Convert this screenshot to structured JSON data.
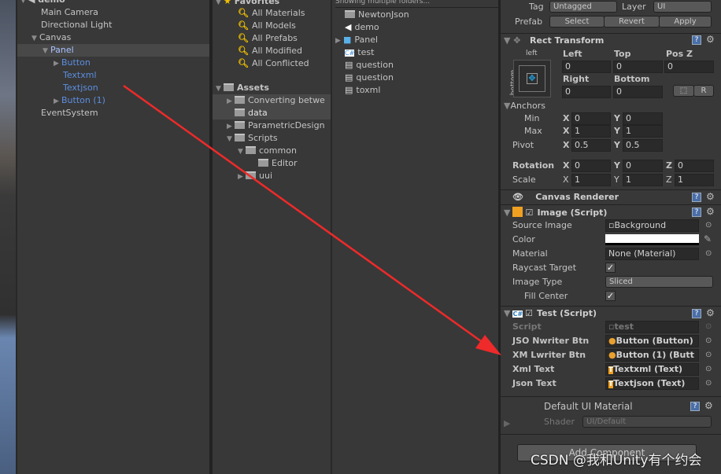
{
  "hierarchy": {
    "scene": "demo",
    "items": [
      {
        "label": "Main Camera"
      },
      {
        "label": "Directional Light"
      },
      {
        "label": "Canvas"
      },
      {
        "label": "Panel"
      },
      {
        "label": "Button"
      },
      {
        "label": "Textxml"
      },
      {
        "label": "Textjson"
      },
      {
        "label": "Button (1)"
      },
      {
        "label": "EventSystem"
      }
    ]
  },
  "project": {
    "favorites_label": "Favorites",
    "favorites": [
      "All Materials",
      "All Models",
      "All Prefabs",
      "All Modified",
      "All Conflicted"
    ],
    "assets_label": "Assets",
    "assets": [
      "Converting betwe",
      "data",
      "ParametricDesign",
      "Scripts",
      "common",
      "Editor",
      "uui"
    ],
    "breadcrumb": "Showing multiple folders...",
    "files": [
      "NewtonJson",
      "demo",
      "Panel",
      "test",
      "question",
      "question",
      "toxml"
    ]
  },
  "inspector": {
    "tag_label": "Tag",
    "tag_value": "Untagged",
    "layer_label": "Layer",
    "layer_value": "UI",
    "prefab_label": "Prefab",
    "select": "Select",
    "revert": "Revert",
    "apply": "Apply",
    "rect": {
      "title": "Rect Transform",
      "anchor_h": "left",
      "anchor_v": "bottom",
      "left_label": "Left",
      "left": "0",
      "top_label": "Top",
      "top": "0",
      "posz_label": "Pos Z",
      "posz": "0",
      "right_label": "Right",
      "right": "0",
      "bottom_label": "Bottom",
      "bottom": "0",
      "r_btn": "R",
      "anchors_label": "Anchors",
      "min_label": "Min",
      "min_x": "0",
      "min_y": "0",
      "max_label": "Max",
      "max_x": "1",
      "max_y": "1",
      "pivot_label": "Pivot",
      "pivot_x": "0.5",
      "pivot_y": "0.5",
      "rotation_label": "Rotation",
      "rot_x": "0",
      "rot_y": "0",
      "rot_z": "0",
      "scale_label": "Scale",
      "scale_x": "1",
      "scale_y": "1",
      "scale_z": "1",
      "x": "X",
      "y": "Y",
      "z": "Z"
    },
    "canvas_renderer": "Canvas Renderer",
    "image": {
      "title": "Image (Script)",
      "source_label": "Source Image",
      "source": "Background",
      "color_label": "Color",
      "color": "#ffffff",
      "material_label": "Material",
      "material": "None (Material)",
      "raycast_label": "Raycast Target",
      "raycast": true,
      "type_label": "Image Type",
      "type": "Sliced",
      "fill_label": "Fill Center",
      "fill": true
    },
    "test": {
      "title": "Test (Script)",
      "script_label": "Script",
      "script": "test",
      "json_btn_label": "JSO Nwriter Btn",
      "json_btn": "Button (Button)",
      "xml_btn_label": "XM Lwriter Btn",
      "xml_btn": "Button (1) (Butt",
      "xml_text_label": "Xml Text",
      "xml_text": "Textxml (Text)",
      "json_text_label": "Json Text",
      "json_text": "Textjson (Text)"
    },
    "material": {
      "title": "Default UI Material",
      "shader_label": "Shader",
      "shader": "UI/Default"
    },
    "add_component": "Add Component"
  },
  "watermark": "CSDN @我和Unity有个约会",
  "annotation_color": "#ee2a2a"
}
